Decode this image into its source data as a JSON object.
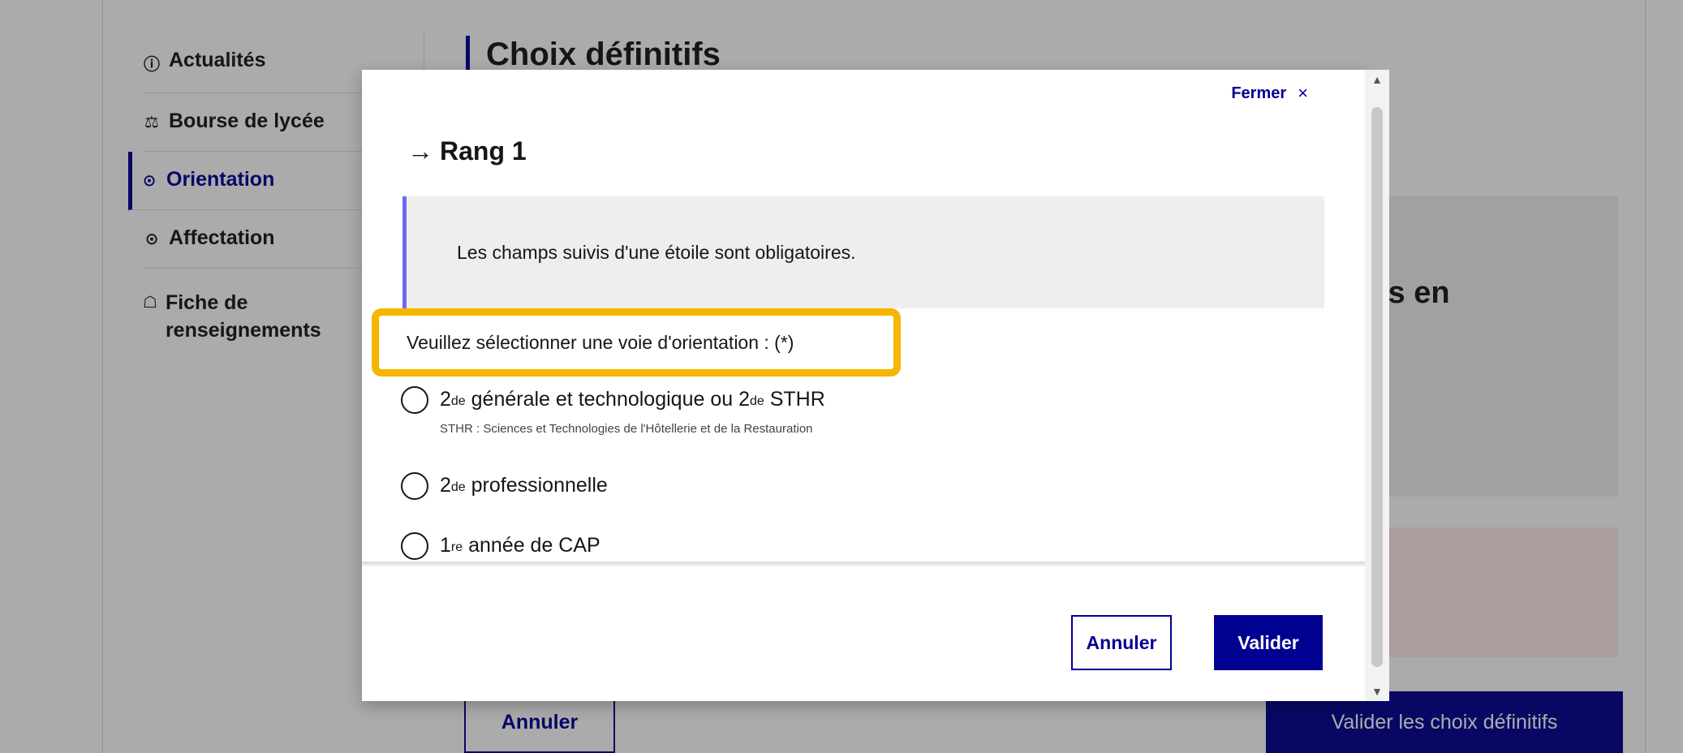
{
  "background": {
    "sidebar": {
      "items": [
        {
          "icon": "ⓘ",
          "label": "Actualités"
        },
        {
          "icon": "⚖",
          "label": "Bourse de lycée"
        },
        {
          "icon": "⊙",
          "label": "Orientation",
          "active": true
        },
        {
          "icon": "⊙",
          "label": "Affectation"
        },
        {
          "icon": "☖",
          "label": "Fiche de renseignements"
        }
      ]
    },
    "page_title": "Choix définitifs",
    "partial_text": "is en",
    "annuler_label": "Annuler",
    "valider_label": "Valider les choix définitifs"
  },
  "modal": {
    "close_label": "Fermer",
    "close_icon": "×",
    "title_arrow": "→",
    "title": "Rang 1",
    "notice": "Les champs suivis d'une étoile sont obligatoires.",
    "legend": "Veuillez sélectionner une voie d'orientation : (*)",
    "options": [
      {
        "prefix": "2",
        "sup1": "de",
        "mid": " générale et technologique ou 2",
        "sup2": "de",
        "suffix": " STHR",
        "hint": "STHR : Sciences et Technologies de l'Hôtellerie et de la Restauration"
      },
      {
        "prefix": "2",
        "sup1": "de",
        "mid": " professionnelle"
      },
      {
        "prefix": "1",
        "sup1": "re",
        "mid": " année de CAP"
      }
    ],
    "cancel_label": "Annuler",
    "submit_label": "Valider"
  },
  "colors": {
    "primary": "#000091",
    "highlight": "#f7b500",
    "notice_border": "#6a6af4"
  }
}
